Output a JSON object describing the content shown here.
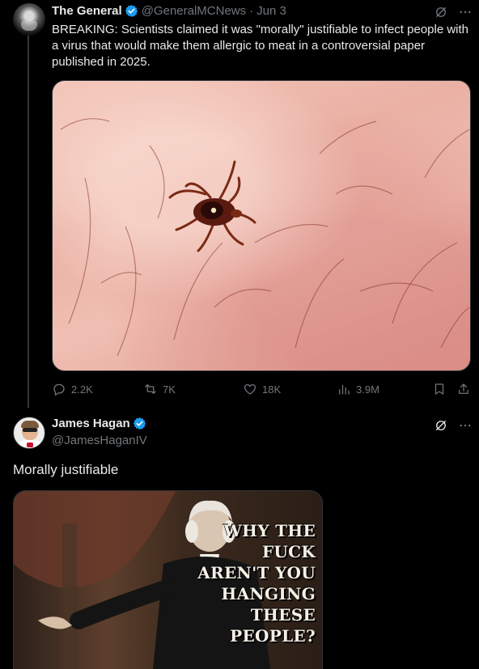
{
  "tweet": {
    "author_name": "The General",
    "handle": "@GeneralMCNews",
    "separator": "·",
    "date": "Jun 3",
    "text": "BREAKING: Scientists claimed it was \"morally\" justifiable to infect people with a virus that would make them allergic to meat in a controversial paper published in 2025.",
    "stats": {
      "replies": "2.2K",
      "retweets": "7K",
      "likes": "18K",
      "views": "3.9M"
    }
  },
  "reply": {
    "author_name": "James Hagan",
    "handle": "@JamesHaganIV",
    "text": "Morally justifiable",
    "meme_lines": [
      "WHY THE",
      "FUCK",
      "AREN'T YOU",
      "HANGING",
      "THESE",
      "PEOPLE?"
    ]
  },
  "icons": {
    "verified": "verified-badge-icon",
    "grok": "grok-icon",
    "more": "more-icon",
    "reply": "reply-icon",
    "retweet": "retweet-icon",
    "like": "heart-icon",
    "views": "views-icon",
    "bookmark": "bookmark-icon",
    "share": "share-icon"
  },
  "colors": {
    "background": "#000000",
    "text_primary": "#e7e9ea",
    "text_secondary": "#71767b",
    "verified_blue": "#1d9bf0",
    "divider": "#2f3336"
  }
}
